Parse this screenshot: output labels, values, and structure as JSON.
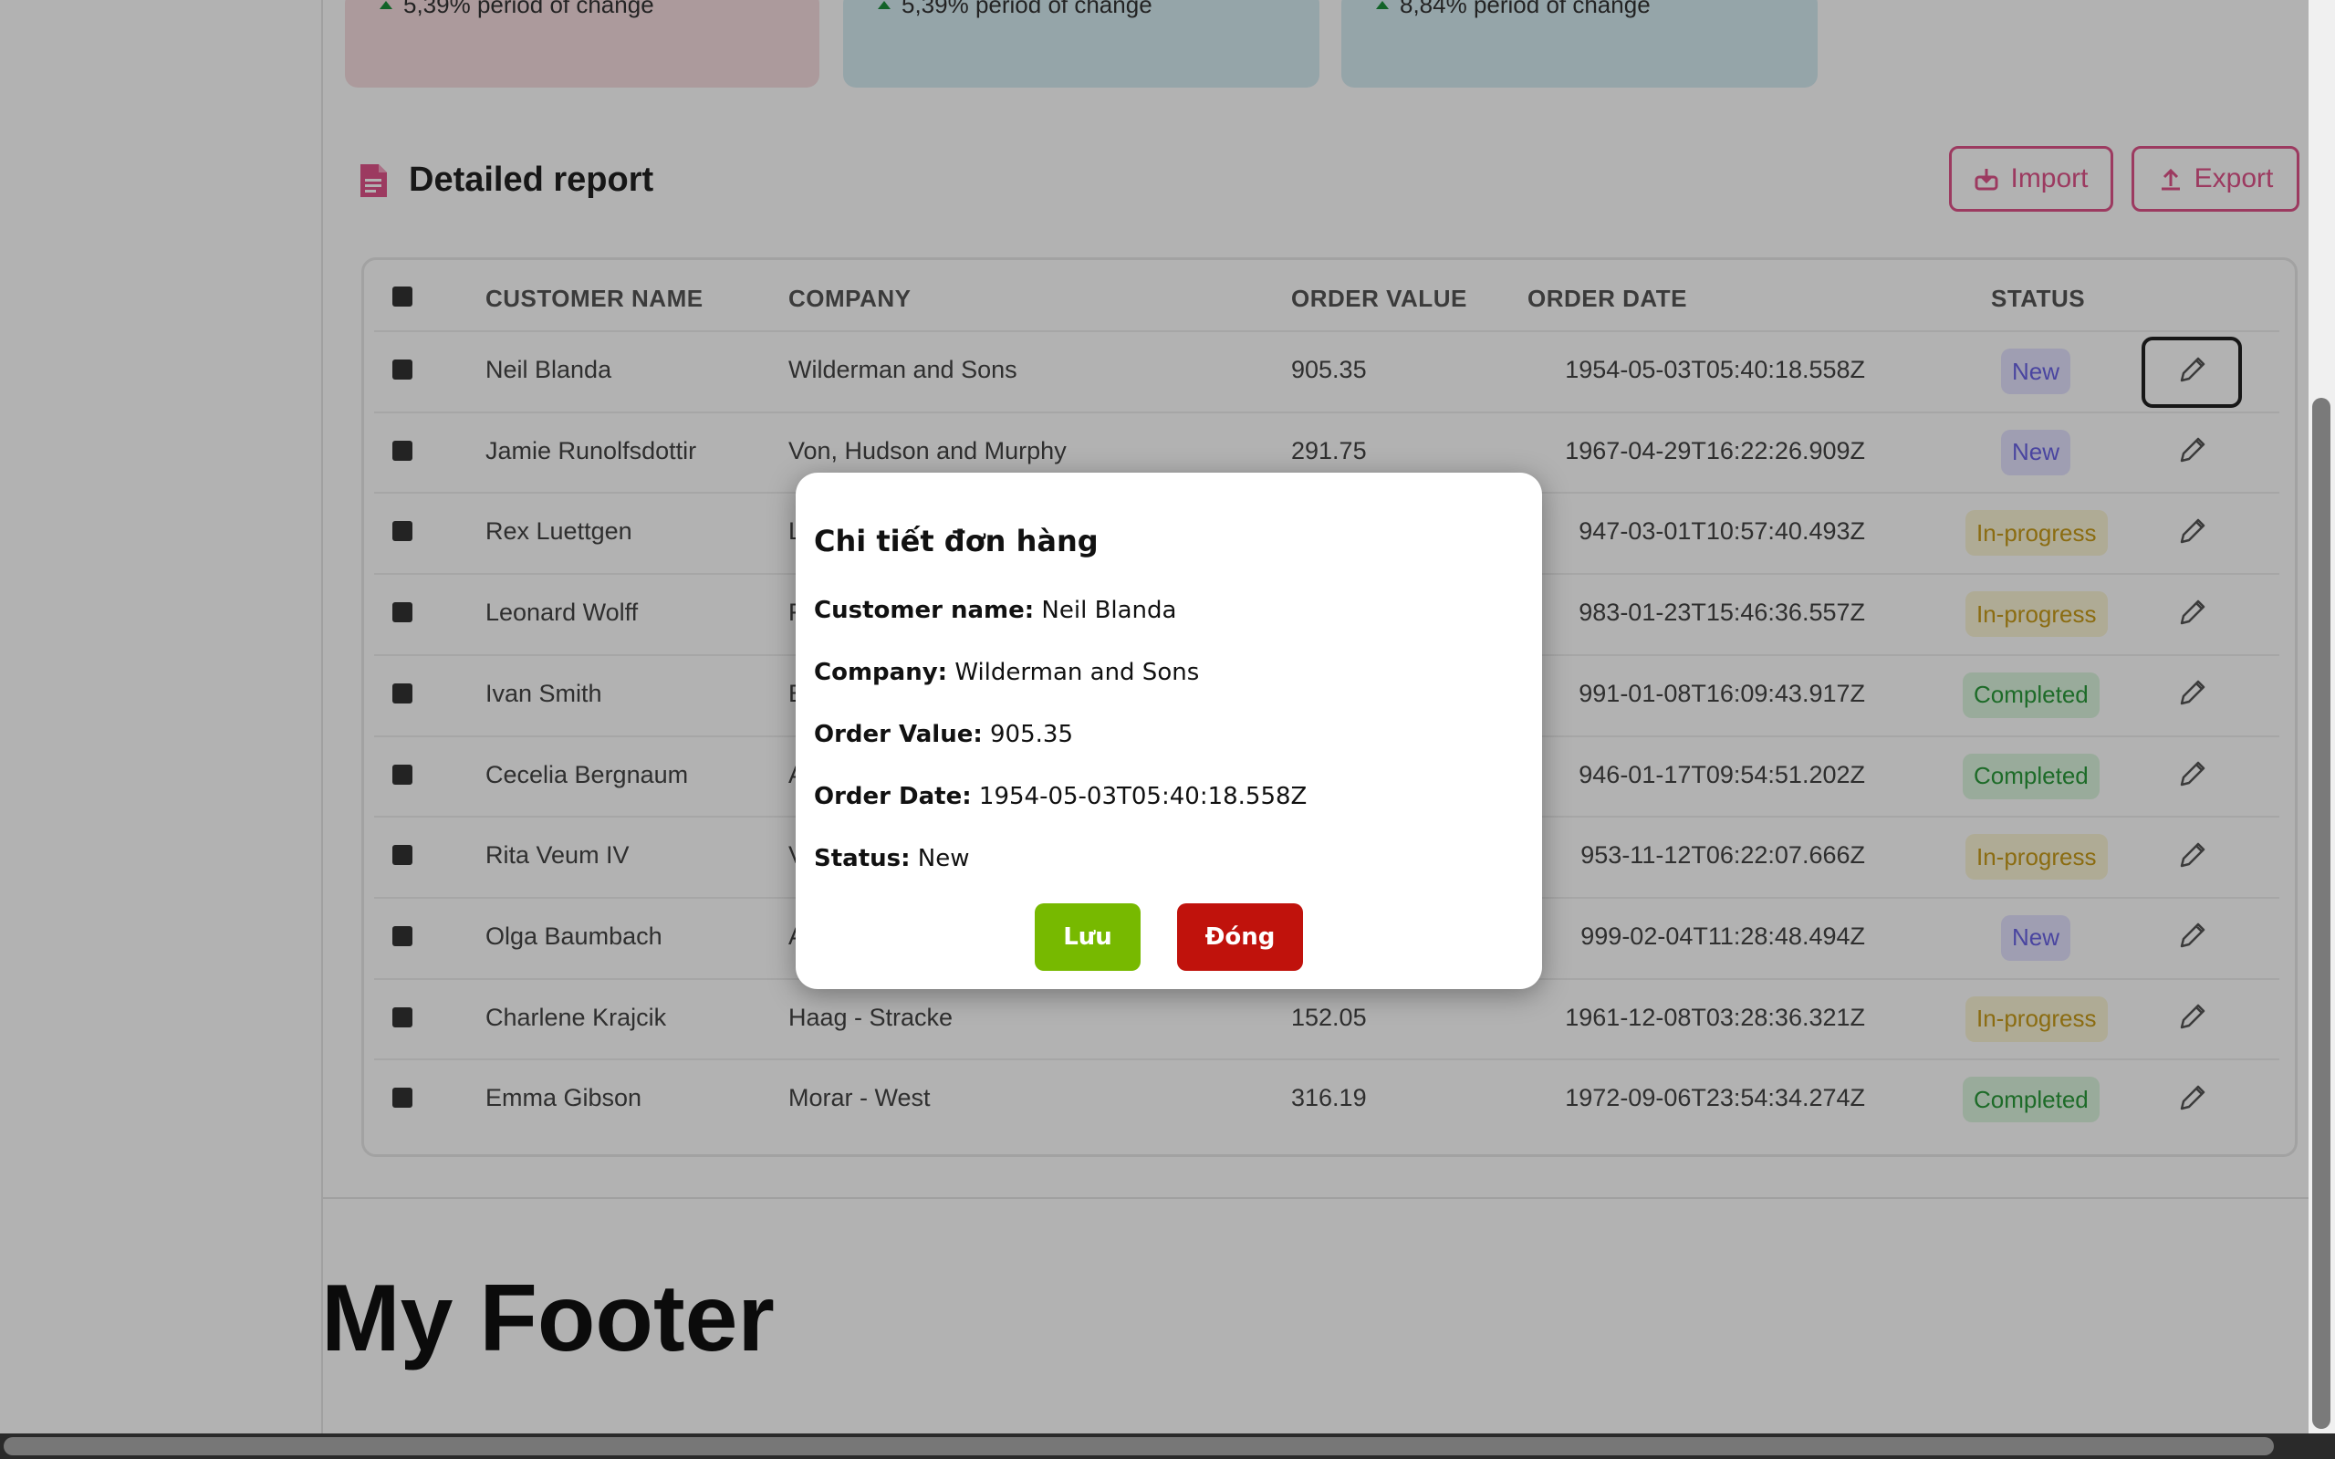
{
  "cards": [
    {
      "change": "5,39% period of change",
      "color": "#f6dde0"
    },
    {
      "change": "5,39% period of change",
      "color": "#d6ecf3"
    },
    {
      "change": "8,84% period of change",
      "color": "#d6ecf3"
    }
  ],
  "report": {
    "title": "Detailed report",
    "import_label": "Import",
    "export_label": "Export",
    "accent": "#e0538a"
  },
  "table": {
    "columns": [
      "CUSTOMER NAME",
      "COMPANY",
      "ORDER VALUE",
      "ORDER DATE",
      "STATUS"
    ],
    "rows": [
      {
        "name": "Neil Blanda",
        "company": "Wilderman and Sons",
        "value": "905.35",
        "date": "1954-05-03T05:40:18.558Z",
        "status": "New"
      },
      {
        "name": "Jamie Runolfsdottir",
        "company": "Von, Hudson and Murphy",
        "value": "291.75",
        "date": "1967-04-29T16:22:26.909Z",
        "status": "New"
      },
      {
        "name": "Rex Luettgen",
        "company": "L",
        "value": "",
        "date": "947-03-01T10:57:40.493Z",
        "status": "In-progress"
      },
      {
        "name": "Leonard Wolff",
        "company": "F",
        "value": "",
        "date": "983-01-23T15:46:36.557Z",
        "status": "In-progress"
      },
      {
        "name": "Ivan Smith",
        "company": "E",
        "value": "",
        "date": "991-01-08T16:09:43.917Z",
        "status": "Completed"
      },
      {
        "name": "Cecelia Bergnaum",
        "company": "A",
        "value": "",
        "date": "946-01-17T09:54:51.202Z",
        "status": "Completed"
      },
      {
        "name": "Rita Veum IV",
        "company": "V",
        "value": "",
        "date": "953-11-12T06:22:07.666Z",
        "status": "In-progress"
      },
      {
        "name": "Olga Baumbach",
        "company": "A",
        "value": "",
        "date": "999-02-04T11:28:48.494Z",
        "status": "New"
      },
      {
        "name": "Charlene Krajcik",
        "company": "Haag - Stracke",
        "value": "152.05",
        "date": "1961-12-08T03:28:36.321Z",
        "status": "In-progress"
      },
      {
        "name": "Emma Gibson",
        "company": "Morar - West",
        "value": "316.19",
        "date": "1972-09-06T23:54:34.274Z",
        "status": "Completed"
      }
    ]
  },
  "footer": {
    "title": "My Footer"
  },
  "modal": {
    "title": "Chi tiết đơn hàng",
    "fields": [
      {
        "label": "Customer name:",
        "value": "Neil Blanda"
      },
      {
        "label": "Company:",
        "value": "Wilderman and Sons"
      },
      {
        "label": "Order Value:",
        "value": "905.35"
      },
      {
        "label": "Order Date:",
        "value": "1954-05-03T05:40:18.558Z"
      },
      {
        "label": "Status:",
        "value": "New"
      }
    ],
    "save_label": "Lưu",
    "close_label": "Đóng",
    "save_color": "#77b900",
    "close_color": "#c0120c"
  }
}
